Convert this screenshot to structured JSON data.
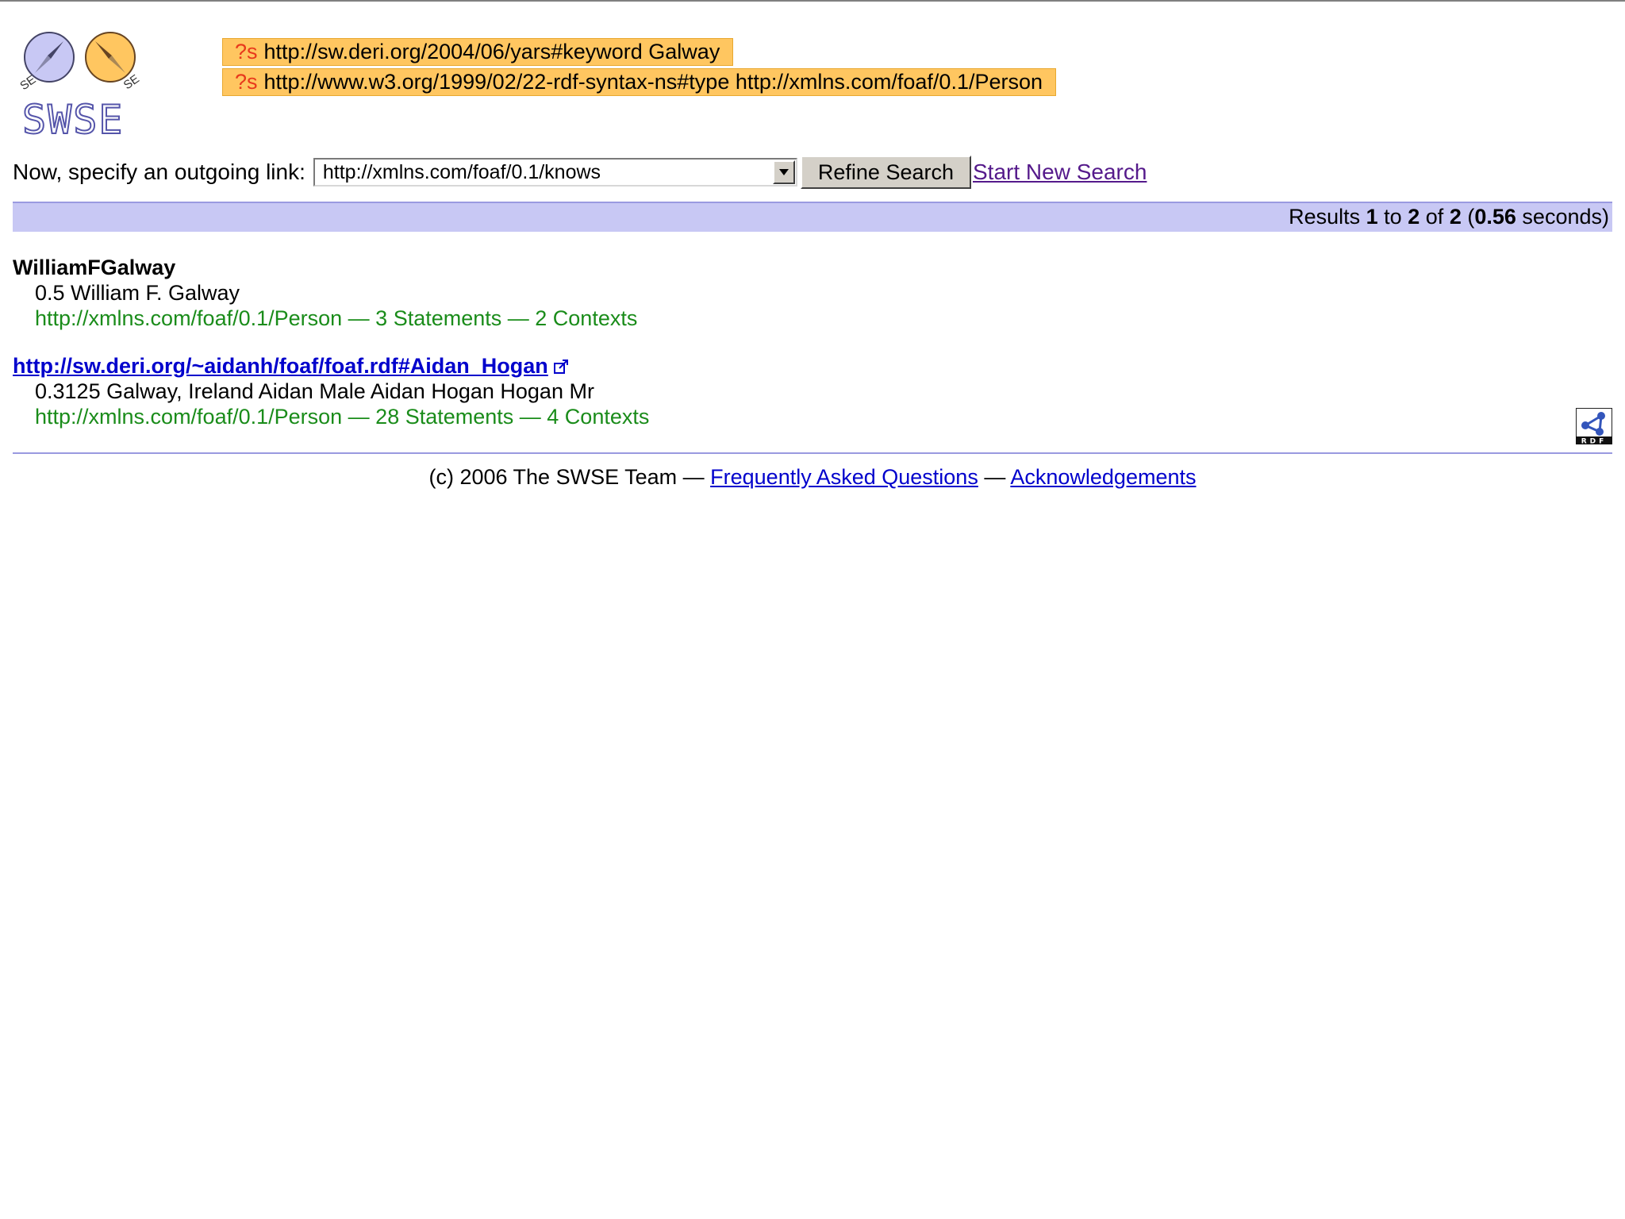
{
  "logo": {
    "text": "SWSE",
    "badge_left": "SE",
    "badge_right": "SE"
  },
  "query": {
    "clauses": [
      {
        "var": "?s",
        "text": "http://sw.deri.org/2004/06/yars#keyword Galway"
      },
      {
        "var": "?s",
        "text": "http://www.w3.org/1999/02/22-rdf-syntax-ns#type http://xmlns.com/foaf/0.1/Person"
      }
    ]
  },
  "controls": {
    "label": "Now, specify an outgoing link:",
    "select_value": "http://xmlns.com/foaf/0.1/knows",
    "refine_label": "Refine Search",
    "new_search_label": "Start New Search"
  },
  "results_bar": {
    "prefix": "Results",
    "from": "1",
    "to_word": "to",
    "to": "2",
    "of_word": "of",
    "total": "2",
    "time": "0.56",
    "seconds_word": "seconds"
  },
  "results": [
    {
      "title": "WilliamFGalway",
      "snippet": "0.5 William F. Galway",
      "meta": "http://xmlns.com/foaf/0.1/Person — 3 Statements — 2 Contexts"
    },
    {
      "title": "http://sw.deri.org/~aidanh/foaf/foaf.rdf#Aidan_Hogan",
      "snippet": "0.3125 Galway, Ireland Aidan Male Aidan Hogan Hogan Mr",
      "meta": "http://xmlns.com/foaf/0.1/Person — 28 Statements — 4 Contexts"
    }
  ],
  "rdf_icon_text": "RDF",
  "footer": {
    "copyright": "(c) 2006 The SWSE Team —",
    "faq_label": "Frequently Asked Questions",
    "separator": "—",
    "ack_label": "Acknowledgements"
  },
  "colors": {
    "pill_bg": "#ffc660",
    "var_red": "#e8391c",
    "results_bar_bg": "#c8c8f4",
    "meta_green": "#1a8c1a",
    "link_blue": "#0000cc",
    "visited_purple": "#551a8b"
  }
}
